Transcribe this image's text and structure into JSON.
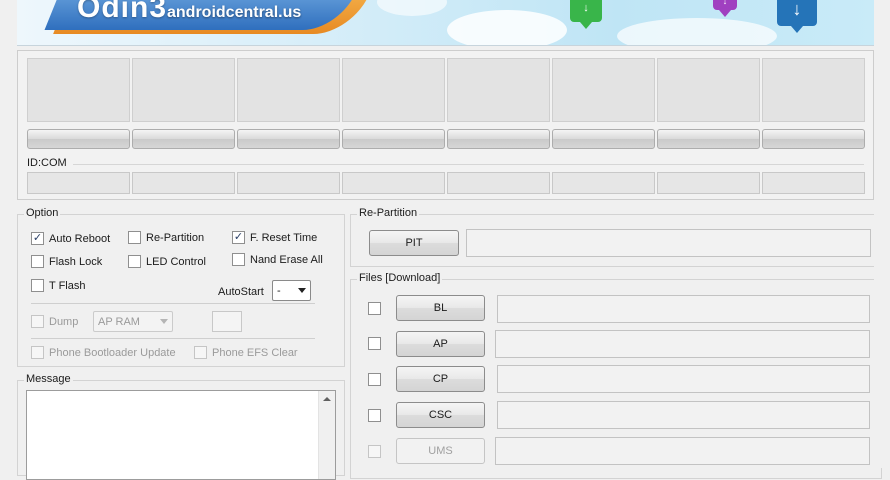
{
  "banner": {
    "logo_text": "Odin3",
    "logo_sub": "androidcentral.us",
    "colors": {
      "orange": "#e78a23",
      "blue": "#2f6fbe",
      "green": "#39b54a",
      "purple": "#a040c0",
      "navy": "#2574b8"
    }
  },
  "ports": {
    "slot_count": 8,
    "id_com_label": "ID:COM"
  },
  "option": {
    "title": "Option",
    "auto_reboot": {
      "label": "Auto Reboot",
      "checked": true
    },
    "re_partition": {
      "label": "Re-Partition",
      "checked": false
    },
    "f_reset_time": {
      "label": "F. Reset Time",
      "checked": true
    },
    "flash_lock": {
      "label": "Flash Lock",
      "checked": false
    },
    "led_control": {
      "label": "LED Control",
      "checked": false
    },
    "nand_erase_all": {
      "label": "Nand Erase All",
      "checked": false
    },
    "t_flash": {
      "label": "T Flash",
      "checked": false
    },
    "autostart_label": "AutoStart",
    "autostart_value": "-",
    "dump": {
      "label": "Dump",
      "checked": false
    },
    "dump_combo_value": "AP RAM",
    "phone_bootloader_update": {
      "label": "Phone Bootloader Update",
      "checked": false
    },
    "phone_efs_clear": {
      "label": "Phone EFS Clear",
      "checked": false
    }
  },
  "message": {
    "title": "Message",
    "content": ""
  },
  "repartition": {
    "title": "Re-Partition",
    "pit_label": "PIT"
  },
  "files": {
    "title": "Files [Download]",
    "rows": [
      {
        "label": "BL",
        "enabled": true
      },
      {
        "label": "AP",
        "enabled": true
      },
      {
        "label": "CP",
        "enabled": true
      },
      {
        "label": "CSC",
        "enabled": true
      },
      {
        "label": "UMS",
        "enabled": false
      }
    ]
  }
}
